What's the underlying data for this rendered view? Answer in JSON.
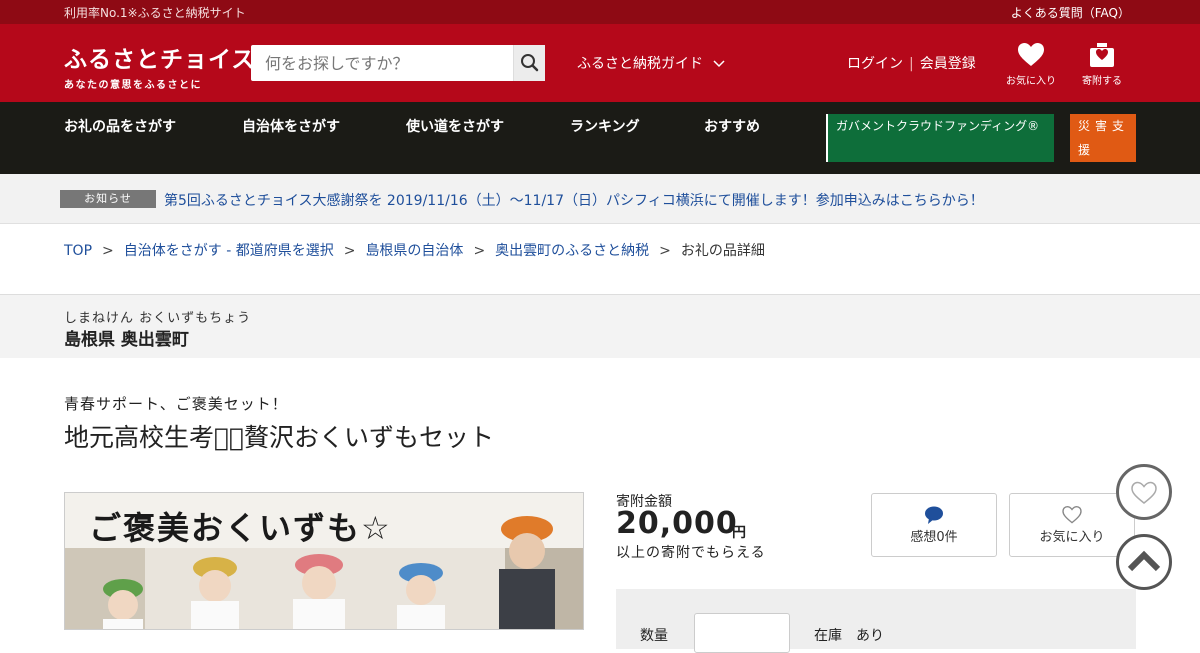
{
  "topbar": {
    "tagline": "利用率No.1※ふるさと納税サイト",
    "faq": "よくある質問（FAQ）"
  },
  "header": {
    "logo_title": "ふるさとチョイス",
    "logo_sub": "あなたの意思をふるさとに",
    "search_placeholder": "何をお探しですか？",
    "guide_label": "ふるさと納税ガイド",
    "login_label": "ログイン",
    "register_label": "会員登録",
    "favorites_label": "お気に入り",
    "donate_label": "寄附する"
  },
  "nav": {
    "items": [
      "お礼の品をさがす",
      "自治体をさがす",
      "使い道をさがす",
      "ランキング",
      "おすすめ"
    ],
    "gov_cf": "ガバメントクラウドファンディング®",
    "disaster": "災害支援"
  },
  "notice": {
    "badge": "お知らせ",
    "text": "第5回ふるさとチョイス大感謝祭を 2019/11/16（土）〜11/17（日）パシフィコ横浜にて開催します！参加申込みはこちらから！"
  },
  "breadcrumb": {
    "items": [
      "TOP",
      "自治体をさがす - 都道府県を選択",
      "島根県の自治体",
      "奥出雲町のふるさと納税"
    ],
    "current": "お礼の品詳細"
  },
  "municipality": {
    "kana": "しまねけん おくいずもちょう",
    "name": "島根県 奥出雲町"
  },
  "product": {
    "catchphrase": "青春サポート、ご褒美セット！",
    "title": "地元高校生考案⃣贅沢おくいずもセット",
    "image_caption": "ご褒美おくいずも☆"
  },
  "donation": {
    "label": "寄附金額",
    "amount": "20,000",
    "unit": "円",
    "note": "以上の寄附でもらえる",
    "reviews_label": "感想0件",
    "favorite_label": "お気に入り"
  },
  "order": {
    "qty_label": "数量",
    "stock_label": "在庫　あり"
  },
  "colors": {
    "brand_red": "#b5081a",
    "dark_red": "#8e0a14",
    "nav_dark": "#1b1b16",
    "green": "#0e6e3a",
    "orange": "#e05a14",
    "link": "#1f4f9b"
  }
}
